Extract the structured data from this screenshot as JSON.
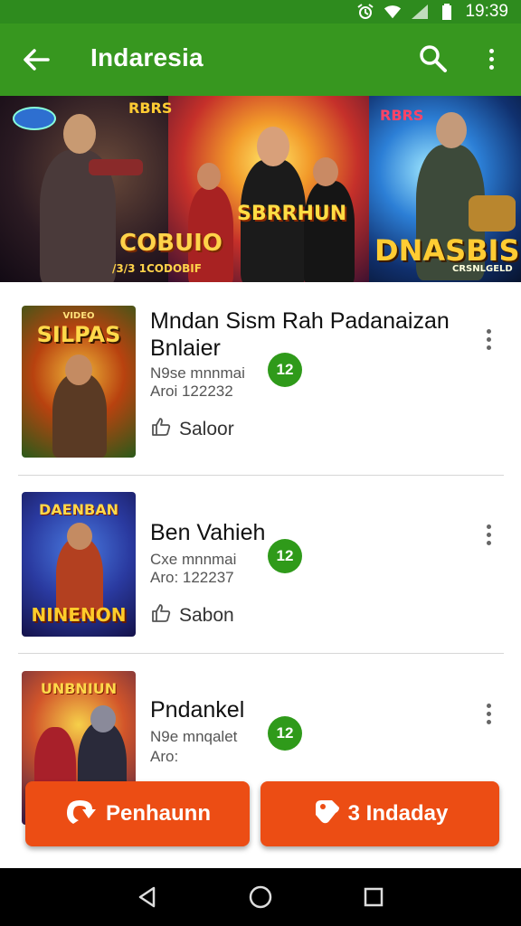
{
  "status_bar": {
    "time": "19:39",
    "icons": [
      "alarm-icon",
      "wifi-icon",
      "signal-icon",
      "battery-icon"
    ]
  },
  "app_bar": {
    "title": "Indaresia",
    "icons": [
      "back-arrow-icon",
      "search-icon",
      "more-vert-icon"
    ]
  },
  "banner": {
    "captions": [
      "COBUIO",
      "SBRRHUN",
      "DNASBIS"
    ],
    "small_captions": [
      "/3/3 1CODOBIF",
      "CRSNLGELD",
      "RBRS"
    ]
  },
  "items": [
    {
      "title": "Mndan Sism Rah Padanaizan Bnlaier",
      "line1": "N9se mnnmai",
      "line2": "Aroi 122232",
      "badge": "12",
      "like_label": "Saloor",
      "thumb_caption": "SILPAS",
      "thumb_top": "VIDEO"
    },
    {
      "title": "Ben Vahieh",
      "line1": "Cxe mnnmai",
      "line2": "Aro: 122237",
      "badge": "12",
      "like_label": "Sabon",
      "thumb_caption": "NINENON",
      "thumb_top": "DAENBAN"
    },
    {
      "title": "Pndankel",
      "line1": "N9e mnqalet",
      "line2": "Aro:",
      "badge": "12",
      "like_label": "",
      "thumb_caption": "",
      "thumb_top": "UNBNIUN"
    }
  ],
  "actions": {
    "primary": {
      "label": "Penhaunn",
      "icon": "share-icon"
    },
    "secondary": {
      "label": "3 Indaday",
      "icon": "tag-icon"
    }
  },
  "colors": {
    "green_dark": "#2e8b1e",
    "green": "#37971f",
    "badge": "#2f9a1a",
    "orange": "#ec4d14"
  },
  "nav_bar": {
    "icons": [
      "back-triangle-icon",
      "home-circle-icon",
      "recents-square-icon"
    ]
  }
}
